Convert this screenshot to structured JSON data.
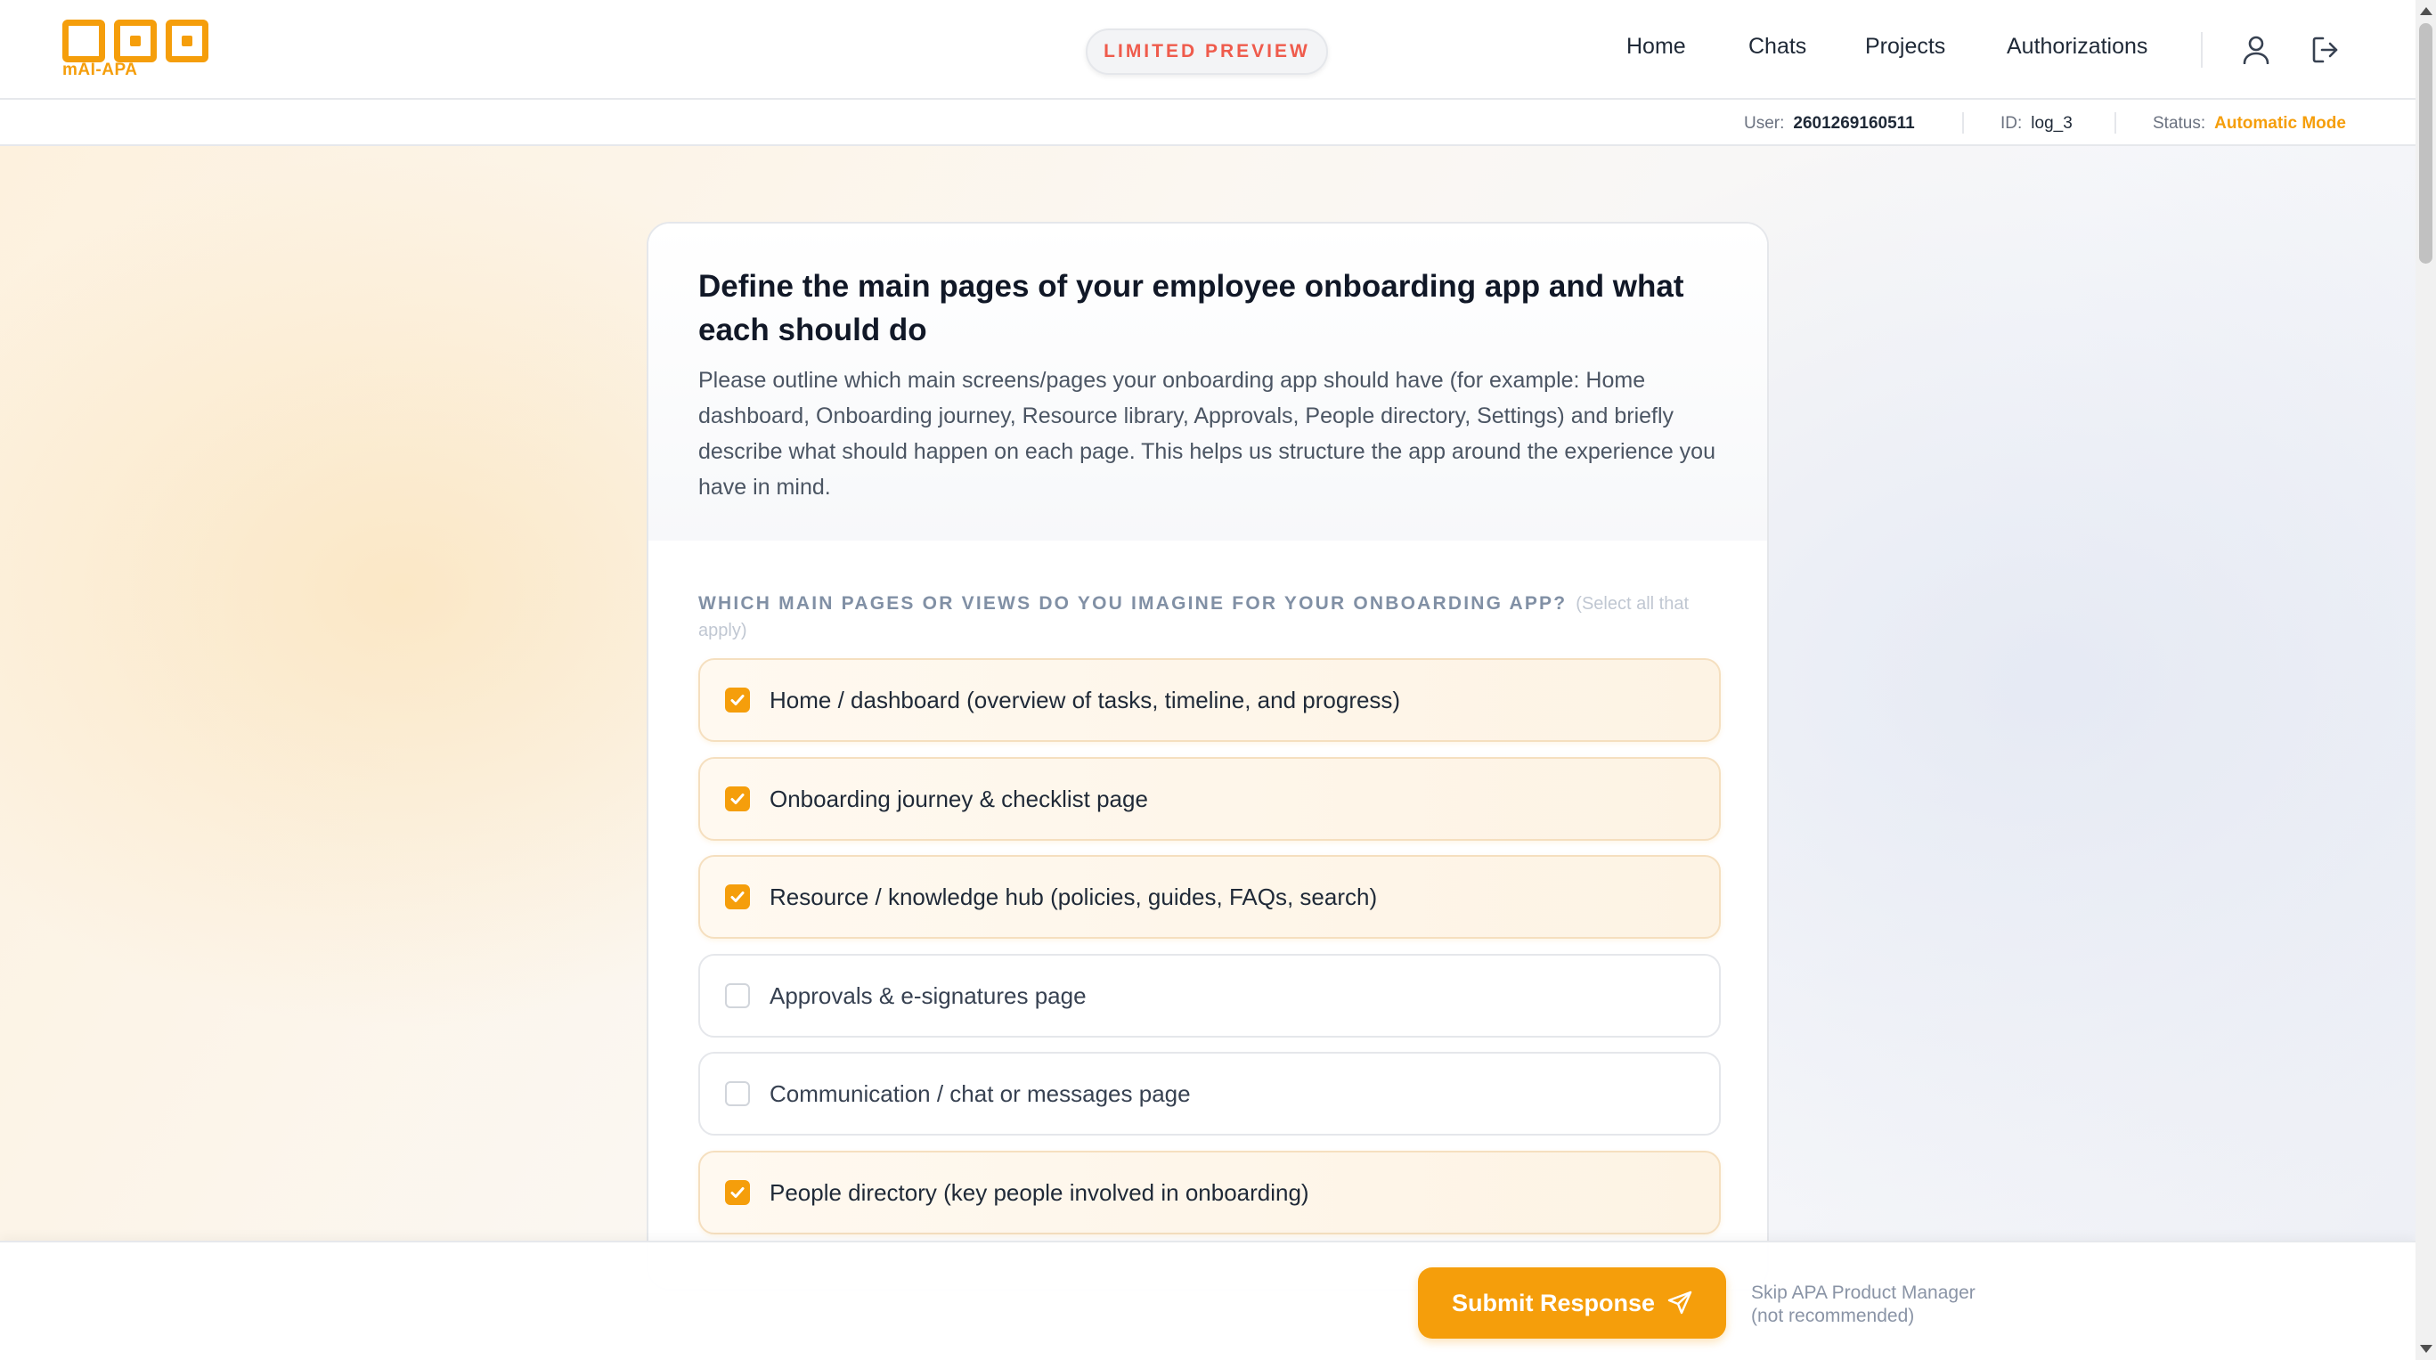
{
  "brand": {
    "logo_text": "mAI-APA",
    "accent_color": "#f59e0b"
  },
  "header": {
    "badge": "LIMITED PREVIEW",
    "nav": [
      {
        "label": "Home"
      },
      {
        "label": "Chats"
      },
      {
        "label": "Projects"
      },
      {
        "label": "Authorizations"
      }
    ],
    "icons": {
      "profile": "user-icon",
      "logout": "logout-icon"
    }
  },
  "session": {
    "user_label": "User:",
    "user_value": "2601269160511",
    "id_label": "ID:",
    "id_value": "log_3",
    "status_label": "Status:",
    "status_value": "Automatic Mode"
  },
  "card": {
    "title": "Define the main pages of your employee onboarding app and what each should do",
    "description": "Please outline which main screens/pages your onboarding app should have (for example: Home dashboard, Onboarding journey, Resource library, Approvals, People directory, Settings) and briefly describe what should happen on each page. This helps us structure the app around the experience you have in mind.",
    "question": "Which main pages or views do you imagine for your onboarding app?",
    "question_hint": "(Select all that apply)",
    "options": [
      {
        "label": "Home / dashboard (overview of tasks, timeline, and progress)",
        "checked": true
      },
      {
        "label": "Onboarding journey & checklist page",
        "checked": true
      },
      {
        "label": "Resource / knowledge hub (policies, guides, FAQs, search)",
        "checked": true
      },
      {
        "label": "Approvals & e-signatures page",
        "checked": false
      },
      {
        "label": "Communication / chat or messages page",
        "checked": false
      },
      {
        "label": "People directory (key people involved in onboarding)",
        "checked": true
      }
    ]
  },
  "footer": {
    "submit_label": "Submit Response",
    "skip_line1": "Skip APA Product Manager",
    "skip_line2": "(not recommended)"
  }
}
